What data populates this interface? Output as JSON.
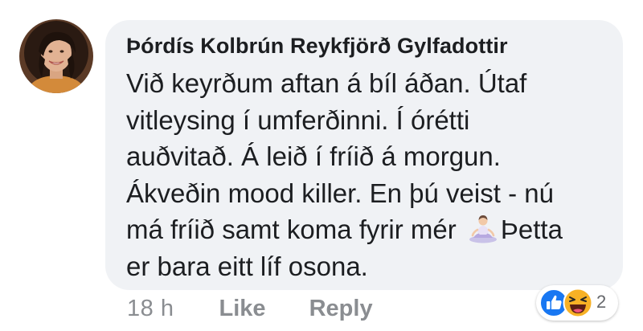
{
  "comment": {
    "author": "Þórdís Kolbrún Reykfjörð Gylfadottir",
    "body_lines": [
      "Við keyrðum aftan á bíl áðan. Útaf",
      "vitleysing í umferðinni. Í órétti",
      "auðvitað. Á leið í fríið á morgun.",
      "Ákveðin mood killer. En þú veist - nú",
      "má fríið samt koma fyrir mér",
      "Þetta",
      "er bara eitt líf osona."
    ],
    "inline_emoji": "person-in-lotus-position-icon",
    "timestamp": "18 h",
    "like_label": "Like",
    "reply_label": "Reply",
    "reactions": {
      "icons": [
        "like-reaction-icon",
        "haha-reaction-icon"
      ],
      "count": "2"
    }
  },
  "colors": {
    "bubble": "#f0f2f5",
    "text": "#1c1e21",
    "meta": "#8a8d91",
    "like_blue": "#1877f2",
    "haha_yellow": "#f7b125"
  }
}
